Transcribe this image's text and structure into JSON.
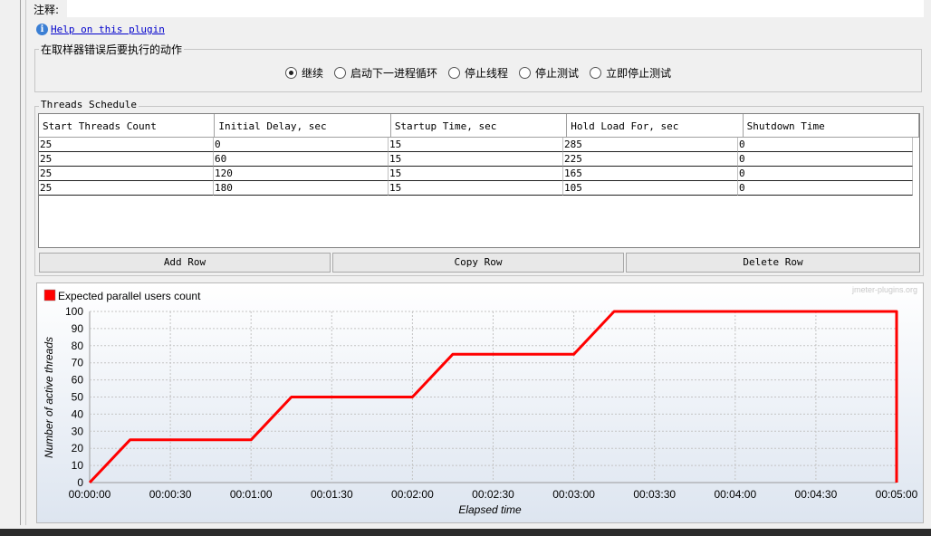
{
  "comment": {
    "label": "注释:"
  },
  "help": {
    "link": "Help on this plugin"
  },
  "sampler_error": {
    "title": "在取样器错误后要执行的动作",
    "options": [
      "继续",
      "启动下一进程循环",
      "停止线程",
      "停止测试",
      "立即停止测试"
    ],
    "selected": 0
  },
  "schedule": {
    "title": "Threads Schedule",
    "columns": [
      "Start Threads Count",
      "Initial Delay, sec",
      "Startup Time, sec",
      "Hold Load For, sec",
      "Shutdown Time"
    ],
    "rows": [
      [
        "25",
        "0",
        "15",
        "285",
        "0"
      ],
      [
        "25",
        "60",
        "15",
        "225",
        "0"
      ],
      [
        "25",
        "120",
        "15",
        "165",
        "0"
      ],
      [
        "25",
        "180",
        "15",
        "105",
        "0"
      ]
    ],
    "buttons": {
      "add": "Add Row",
      "copy": "Copy Row",
      "delete": "Delete Row"
    }
  },
  "colors": {
    "series": "#ff0000"
  },
  "chart_data": {
    "type": "line",
    "watermark": "jmeter-plugins.org",
    "xlabel": "Elapsed time",
    "ylabel": "Number of active threads",
    "xlim": [
      0,
      300
    ],
    "ylim": [
      0,
      100
    ],
    "grid": true,
    "legend": "top-left",
    "x_tick_values": [
      0,
      30,
      60,
      90,
      120,
      150,
      180,
      210,
      240,
      270,
      300
    ],
    "x_ticks": [
      "00:00:00",
      "00:00:30",
      "00:01:00",
      "00:01:30",
      "00:02:00",
      "00:02:30",
      "00:03:00",
      "00:03:30",
      "00:04:00",
      "00:04:30",
      "00:05:00"
    ],
    "y_ticks": [
      0,
      10,
      20,
      30,
      40,
      50,
      60,
      70,
      80,
      90,
      100
    ],
    "series": [
      {
        "name": "Expected parallel users count",
        "x": [
          0,
          15,
          60,
          75,
          120,
          135,
          180,
          195,
          300,
          300
        ],
        "y": [
          0,
          25,
          25,
          50,
          50,
          75,
          75,
          100,
          100,
          0
        ]
      }
    ]
  }
}
